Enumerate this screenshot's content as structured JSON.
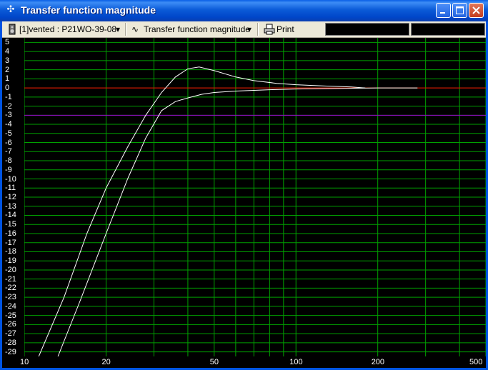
{
  "window": {
    "title": "Transfer function magnitude"
  },
  "toolbar": {
    "project_label": "[1]vented : P21WO-39-08",
    "view_label": "Transfer function magnitude",
    "print_label": "Print"
  },
  "chart_data": {
    "type": "line",
    "title": "",
    "xlabel": "",
    "ylabel": "",
    "x_scale": "log",
    "xlim": [
      10,
      500
    ],
    "ylim": [
      -29.5,
      5.5
    ],
    "x_tick_labels": [
      "10",
      "20",
      "50",
      "100",
      "200",
      "500"
    ],
    "y_tick_labels": [
      "5",
      "4",
      "3",
      "2",
      "1",
      "0",
      "-1",
      "-2",
      "-3",
      "-4",
      "-5",
      "-6",
      "-7",
      "-8",
      "-9",
      "-10",
      "-11",
      "-12",
      "-13",
      "-14",
      "-15",
      "-16",
      "-17",
      "-18",
      "-19",
      "-20",
      "-21",
      "-22",
      "-23",
      "-24",
      "-25",
      "-26",
      "-27",
      "-28",
      "-29"
    ],
    "grid": true,
    "reference_lines": [
      {
        "y": 0,
        "color": "#ff0000"
      },
      {
        "y": -3,
        "color": "#9900cc"
      }
    ],
    "series": [
      {
        "color": "#ffffff",
        "x": [
          11.3,
          14,
          17,
          20,
          24,
          28,
          32,
          36,
          40,
          44,
          50,
          60,
          70,
          85,
          100,
          130,
          160,
          180
        ],
        "y": [
          -29.5,
          -23,
          -16,
          -11,
          -6.5,
          -3,
          -0.5,
          1.2,
          2.1,
          2.3,
          1.9,
          1.2,
          0.8,
          0.5,
          0.35,
          0.2,
          0.1,
          0
        ]
      },
      {
        "color": "#ffffff",
        "x": [
          13.3,
          16,
          20,
          24,
          28,
          32,
          36,
          40,
          45,
          50,
          60,
          80,
          100,
          150,
          200,
          250,
          280
        ],
        "y": [
          -29.5,
          -23.5,
          -16,
          -10,
          -5.5,
          -2.5,
          -1.5,
          -1.1,
          -0.7,
          -0.5,
          -0.35,
          -0.2,
          -0.12,
          -0.05,
          0,
          0,
          0
        ]
      }
    ]
  }
}
